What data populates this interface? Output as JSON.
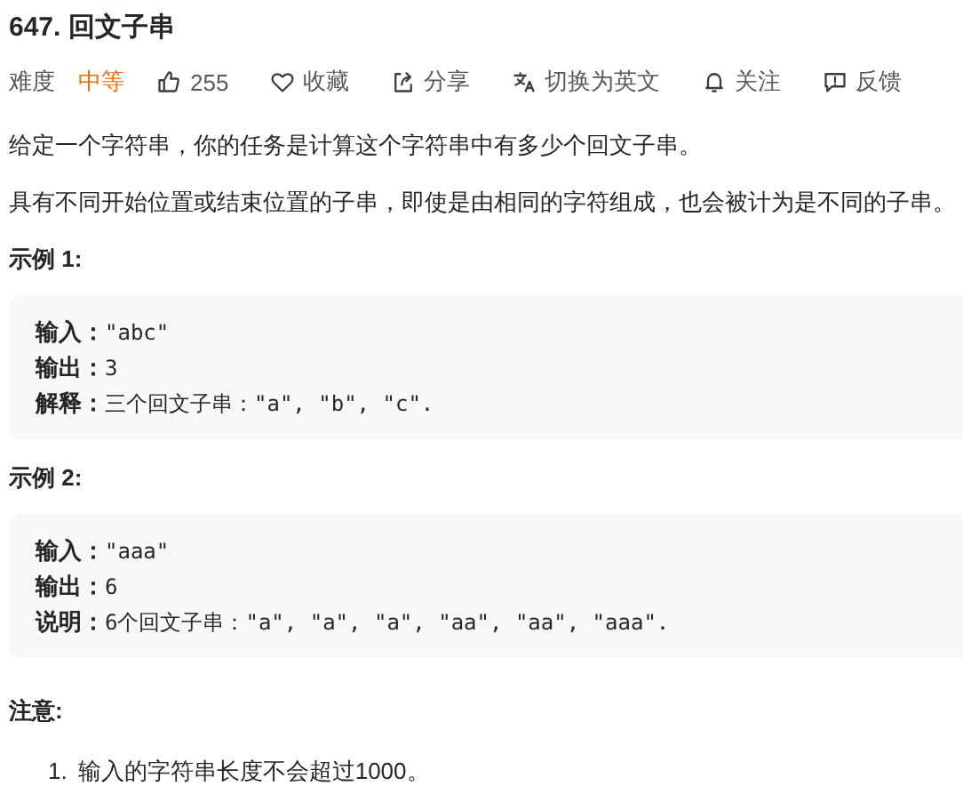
{
  "title": "647. 回文子串",
  "difficulty": {
    "label": "难度",
    "value": "中等"
  },
  "actions": [
    {
      "kind": "like",
      "label": "255"
    },
    {
      "kind": "favorite",
      "label": "收藏"
    },
    {
      "kind": "share",
      "label": "分享"
    },
    {
      "kind": "translate",
      "label": "切换为英文"
    },
    {
      "kind": "follow",
      "label": "关注"
    },
    {
      "kind": "feedback",
      "label": "反馈"
    }
  ],
  "paragraphs": [
    "给定一个字符串，你的任务是计算这个字符串中有多少个回文子串。",
    "具有不同开始位置或结束位置的子串，即使是由相同的字符组成，也会被计为是不同的子串。"
  ],
  "examples": [
    {
      "title": "示例 1:",
      "lines": [
        "**输入：**\"abc\"",
        "**输出：**3",
        "**解释：**三个回文子串：\"a\", \"b\", \"c\"."
      ]
    },
    {
      "title": "示例 2:",
      "lines": [
        "**输入：**\"aaa\"",
        "**输出：**6",
        "**说明：**6个回文子串：\"a\", \"a\", \"a\", \"aa\", \"aa\", \"aaa\"."
      ]
    }
  ],
  "notes": {
    "title": "注意:",
    "items": [
      {
        "number": "1.",
        "text": "输入的字符串长度不会超过1000。"
      }
    ]
  }
}
